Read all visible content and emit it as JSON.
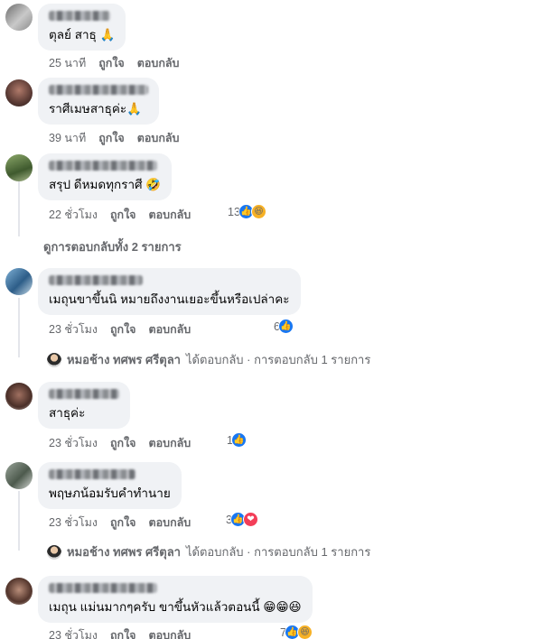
{
  "actions": {
    "like": "ถูกใจ",
    "reply": "ตอบกลับ"
  },
  "comments": [
    {
      "text": "ตุลย์ สาธุ 🙏",
      "time": "25 นาที"
    },
    {
      "text": "ราศีเมษสาธุค่ะ🙏",
      "time": "39 นาที"
    },
    {
      "text": "สรุป ดีหมดทุกราศี 🤣",
      "time": "22 ชั่วโมง",
      "reaction_count": "13",
      "reactions": [
        "like-icon",
        "haha-icon"
      ]
    },
    {
      "text": "เมถุนขาขึ้นนิ หมายถึงงานเยอะขึ้นหรือเปล่าคะ",
      "time": "23 ชั่วโมง",
      "reaction_count": "6",
      "reactions": [
        "like-icon"
      ]
    },
    {
      "text": "สาธุค่ะ",
      "time": "23 ชั่วโมง",
      "reaction_count": "1",
      "reactions": [
        "like-icon"
      ]
    },
    {
      "text": "พฤษภน้อมรับคำทำนาย",
      "time": "23 ชั่วโมง",
      "reaction_count": "3",
      "reactions": [
        "like-icon",
        "love-icon"
      ]
    },
    {
      "text": "เมถุน แม่นมากๆครับ ขาขึ้นหัวแล้วตอนนี้ 😁😁😆",
      "time": "23 ชั่วโมง",
      "reaction_count": "7",
      "reactions": [
        "like-icon",
        "haha-icon"
      ]
    }
  ],
  "view_more_replies": "ดูการตอบกลับทั้ง 2 รายการ",
  "reply_summary": {
    "name": "หมอช้าง ทศพร ศรีตุลา",
    "text": "ได้ตอบกลับ · การตอบกลับ 1 รายการ"
  },
  "colors": {
    "bubble": "#f0f2f5",
    "meta": "#65676b",
    "like": "#1877f2",
    "haha": "#f7b125",
    "love": "#f33e58"
  }
}
